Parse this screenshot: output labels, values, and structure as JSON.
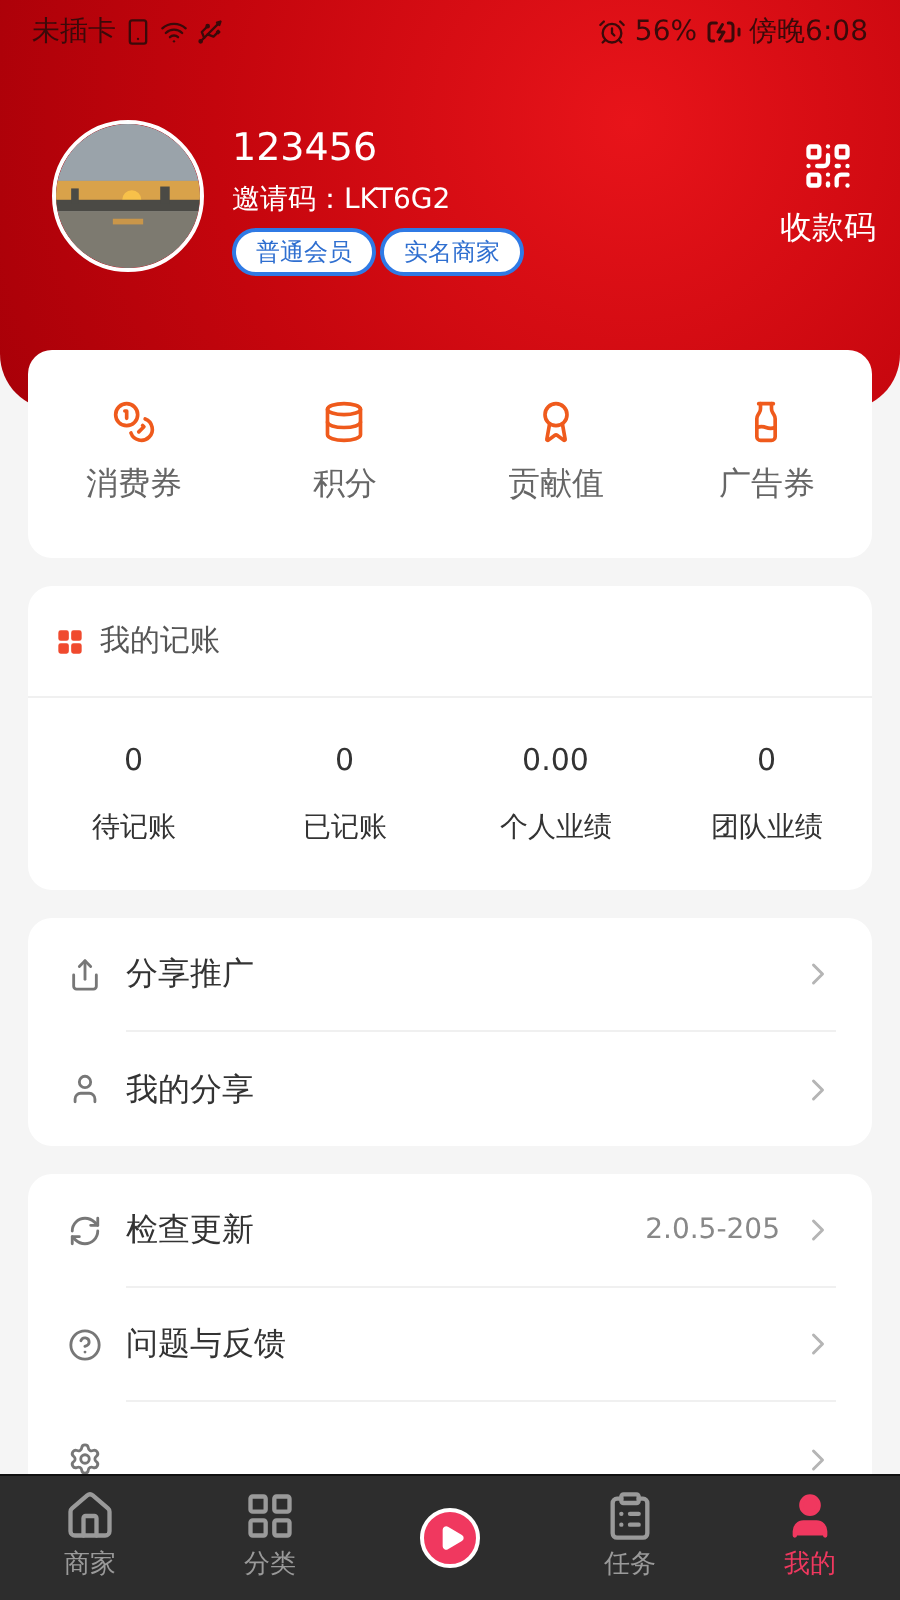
{
  "status_bar": {
    "carrier": "未插卡",
    "battery": "56%",
    "time": "傍晚6:08"
  },
  "profile": {
    "name": "123456",
    "invite_code": "邀请码：LKT6G2",
    "badges": [
      "普通会员",
      "实名商家"
    ],
    "qr_label": "收款码"
  },
  "assets": [
    {
      "kind": "coins",
      "label": "消费券"
    },
    {
      "kind": "stack",
      "label": "积分"
    },
    {
      "kind": "medal",
      "label": "贡献值"
    },
    {
      "kind": "bottle",
      "label": "广告券"
    }
  ],
  "ledger": {
    "title": "我的记账",
    "stats": [
      {
        "value": "0",
        "label": "待记账"
      },
      {
        "value": "0",
        "label": "已记账"
      },
      {
        "value": "0.00",
        "label": "个人业绩"
      },
      {
        "value": "0",
        "label": "团队业绩"
      }
    ]
  },
  "menu_groups": [
    [
      {
        "kind": "share",
        "label": "分享推广"
      },
      {
        "kind": "user",
        "label": "我的分享"
      }
    ],
    [
      {
        "kind": "refresh",
        "label": "检查更新",
        "detail": "2.0.5-205"
      },
      {
        "kind": "help",
        "label": "问题与反馈"
      },
      {
        "kind": "settings"
      }
    ]
  ],
  "tab_bar": [
    {
      "kind": "home",
      "label": "商家",
      "selected": false
    },
    {
      "kind": "grid",
      "label": "分类",
      "selected": false
    },
    {
      "kind": "play"
    },
    {
      "kind": "tasks",
      "label": "任务",
      "selected": false
    },
    {
      "kind": "user",
      "label": "我的",
      "selected": true
    }
  ]
}
